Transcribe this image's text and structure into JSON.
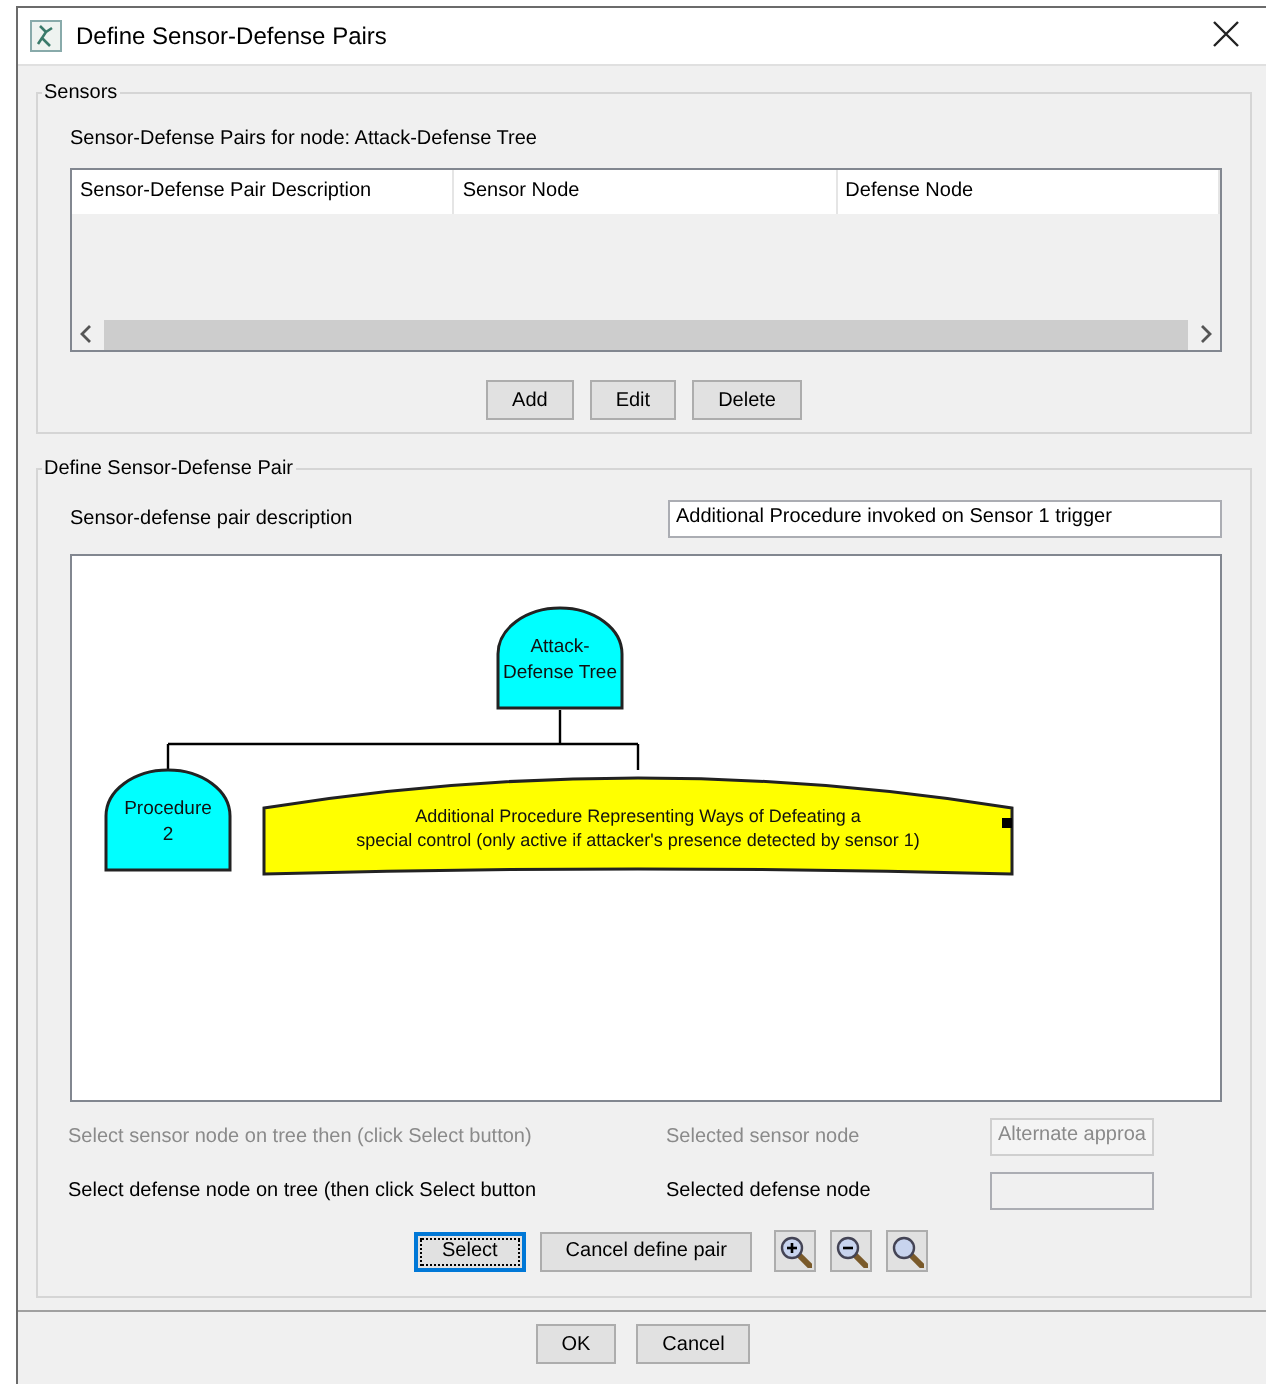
{
  "window": {
    "title": "Define Sensor-Defense Pairs"
  },
  "sensors": {
    "legend": "Sensors",
    "heading": "Sensor-Defense Pairs for node: Attack-Defense Tree",
    "table": {
      "columns": [
        "Sensor-Defense Pair Description",
        "Sensor Node",
        "Defense Node"
      ]
    },
    "buttons": [
      {
        "label": "Add"
      },
      {
        "label": "Edit"
      },
      {
        "label": "Delete"
      }
    ]
  },
  "define_pair": {
    "legend": "Define Sensor-Defense Pair",
    "description": {
      "label": "Sensor-defense pair description",
      "value": "Additional Procedure invoked on Sensor 1 trigger"
    },
    "tree": {
      "label": "Attack-\nDefense Tree",
      "kind": "gate",
      "color": "#00ffff",
      "children": [
        {
          "label": "Procedure\n2",
          "kind": "gate",
          "color": "#00ffff"
        },
        {
          "label": "Additional Procedure Representing Ways of Defeating a\nspecial control (only active if attacker's presence detected by sensor 1)",
          "kind": "banner",
          "color": "#ffff00"
        }
      ]
    },
    "selection_rows": [
      {
        "instruction": "Select sensor node on tree then (click Select button)",
        "field_label": "Selected sensor node",
        "value": "Alternate approa",
        "disabled": true
      },
      {
        "instruction": "Select defense node on tree (then click Select button",
        "field_label": "Selected defense node",
        "disabled": false
      }
    ],
    "buttons": [
      {
        "kind": "text",
        "label": "Select",
        "focused": true
      },
      {
        "kind": "text",
        "label": "Cancel define pair",
        "focused": false
      },
      {
        "kind": "zoom_in",
        "focused": false
      },
      {
        "kind": "zoom_out",
        "focused": false
      },
      {
        "kind": "zoom_reset",
        "focused": false
      }
    ]
  },
  "dialog_buttons": [
    {
      "label": "OK"
    },
    {
      "label": "Cancel"
    }
  ]
}
